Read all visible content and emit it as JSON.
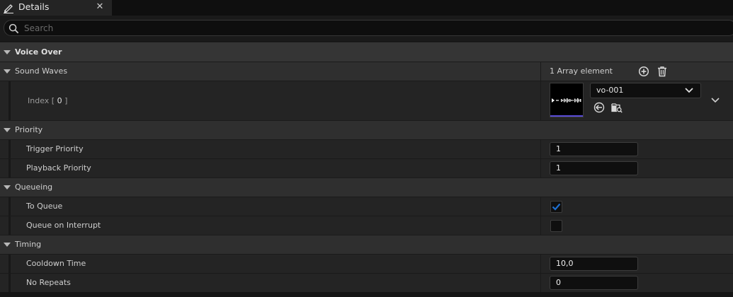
{
  "tab": {
    "title": "Details",
    "close": "✕"
  },
  "search": {
    "placeholder": "Search",
    "value": ""
  },
  "voice_over": {
    "label": "Voice Over"
  },
  "sound_waves": {
    "label": "Sound Waves",
    "count_label": "1 Array element",
    "index_prefix": "Index [ ",
    "index_value": "0",
    "index_suffix": " ]",
    "asset_name": "vo-001"
  },
  "priority": {
    "label": "Priority",
    "trigger_label": "Trigger Priority",
    "trigger_value": "1",
    "playback_label": "Playback Priority",
    "playback_value": "1"
  },
  "queueing": {
    "label": "Queueing",
    "to_queue_label": "To Queue",
    "to_queue_checked": true,
    "interrupt_label": "Queue on Interrupt",
    "interrupt_checked": false
  },
  "timing": {
    "label": "Timing",
    "cooldown_label": "Cooldown Time",
    "cooldown_value": "10,0",
    "no_repeats_label": "No Repeats",
    "no_repeats_value": "0"
  },
  "colors": {
    "accent": "#1e6fd0",
    "thumb_bar": "#5a4cd8"
  }
}
